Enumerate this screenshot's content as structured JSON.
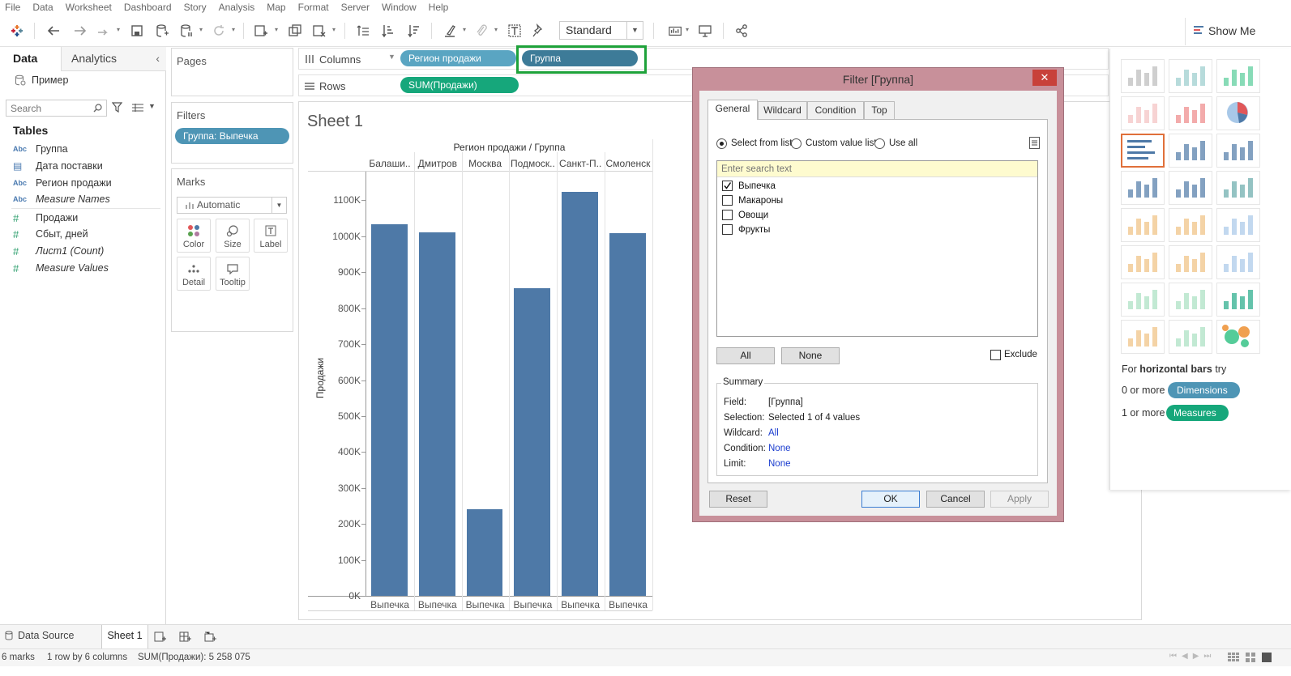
{
  "menu": [
    "File",
    "Data",
    "Worksheet",
    "Dashboard",
    "Story",
    "Analysis",
    "Map",
    "Format",
    "Server",
    "Window",
    "Help"
  ],
  "toolbar": {
    "fit_select": "Standard",
    "show_me": "Show Me"
  },
  "datapane": {
    "tab_data": "Data",
    "tab_analytics": "Analytics",
    "datasource": "Пример",
    "search_placeholder": "Search",
    "tables_header": "Tables",
    "fields": [
      {
        "type": "Abc",
        "name": "Группа"
      },
      {
        "type": "date",
        "name": "Дата поставки"
      },
      {
        "type": "Abc",
        "name": "Регион продажи"
      },
      {
        "type": "Abc",
        "name": "Measure Names"
      },
      {
        "type": "#",
        "name": "Продажи"
      },
      {
        "type": "#",
        "name": "Сбыт, дней"
      },
      {
        "type": "#",
        "name": "Лист1 (Count)"
      },
      {
        "type": "#",
        "name": "Measure Values"
      }
    ]
  },
  "pages": {
    "title": "Pages"
  },
  "filters": {
    "title": "Filters",
    "pill": "Группа: Выпечка"
  },
  "marks": {
    "title": "Marks",
    "type": "Automatic",
    "buttons": [
      "Color",
      "Size",
      "Label",
      "Detail",
      "Tooltip"
    ]
  },
  "shelves": {
    "columns_label": "Columns",
    "rows_label": "Rows",
    "columns_pills": [
      "Регион продажи",
      "Группа"
    ],
    "rows_pills": [
      "SUM(Продажи)"
    ]
  },
  "sheet": {
    "title": "Sheet 1",
    "header": "Регион продажи / Группа",
    "ylabel": "Продажи"
  },
  "chart_data": {
    "type": "bar",
    "categories": [
      "Балаши..",
      "Дмитров",
      "Москва",
      "Подмоск..",
      "Санкт-П..",
      "Смоленск"
    ],
    "sub_category": "Выпечка",
    "values": [
      1033000,
      1010000,
      242000,
      856000,
      1123000,
      1009000
    ],
    "ylabel": "Продажи",
    "yticks": [
      "0K",
      "100K",
      "200K",
      "300K",
      "400K",
      "500K",
      "600K",
      "700K",
      "800K",
      "900K",
      "1000K",
      "1100K"
    ],
    "ylim": [
      0,
      1200000
    ]
  },
  "dialog": {
    "title": "Filter [Группа]",
    "close": "✕",
    "tabs": [
      "General",
      "Wildcard",
      "Condition",
      "Top"
    ],
    "radios": [
      "Select from list",
      "Custom value list",
      "Use all"
    ],
    "search_placeholder": "Enter search text",
    "items": [
      {
        "label": "Выпечка",
        "checked": true
      },
      {
        "label": "Макароны",
        "checked": false
      },
      {
        "label": "Овощи",
        "checked": false
      },
      {
        "label": "Фрукты",
        "checked": false
      }
    ],
    "all_btn": "All",
    "none_btn": "None",
    "exclude": "Exclude",
    "summary_title": "Summary",
    "summary": [
      {
        "k": "Field:",
        "v": "[Группа]",
        "link": false
      },
      {
        "k": "Selection:",
        "v": "Selected 1 of 4 values",
        "link": false
      },
      {
        "k": "Wildcard:",
        "v": "All",
        "link": true
      },
      {
        "k": "Condition:",
        "v": "None",
        "link": true
      },
      {
        "k": "Limit:",
        "v": "None",
        "link": true
      }
    ],
    "reset": "Reset",
    "ok": "OK",
    "cancel": "Cancel",
    "apply": "Apply"
  },
  "showme": {
    "hint_prefix": "For",
    "hint_bold": "horizontal bars",
    "hint_suffix": "try",
    "dim_prefix": "0 or more",
    "dim_pill": "Dimensions",
    "meas_prefix": "1 or more",
    "meas_pill": "Measures"
  },
  "tabs_bar": {
    "datasource": "Data Source",
    "sheet": "Sheet 1"
  },
  "status": {
    "marks": "6 marks",
    "rows": "1 row by 6 columns",
    "sum": "SUM(Продажи): 5 258 075"
  }
}
